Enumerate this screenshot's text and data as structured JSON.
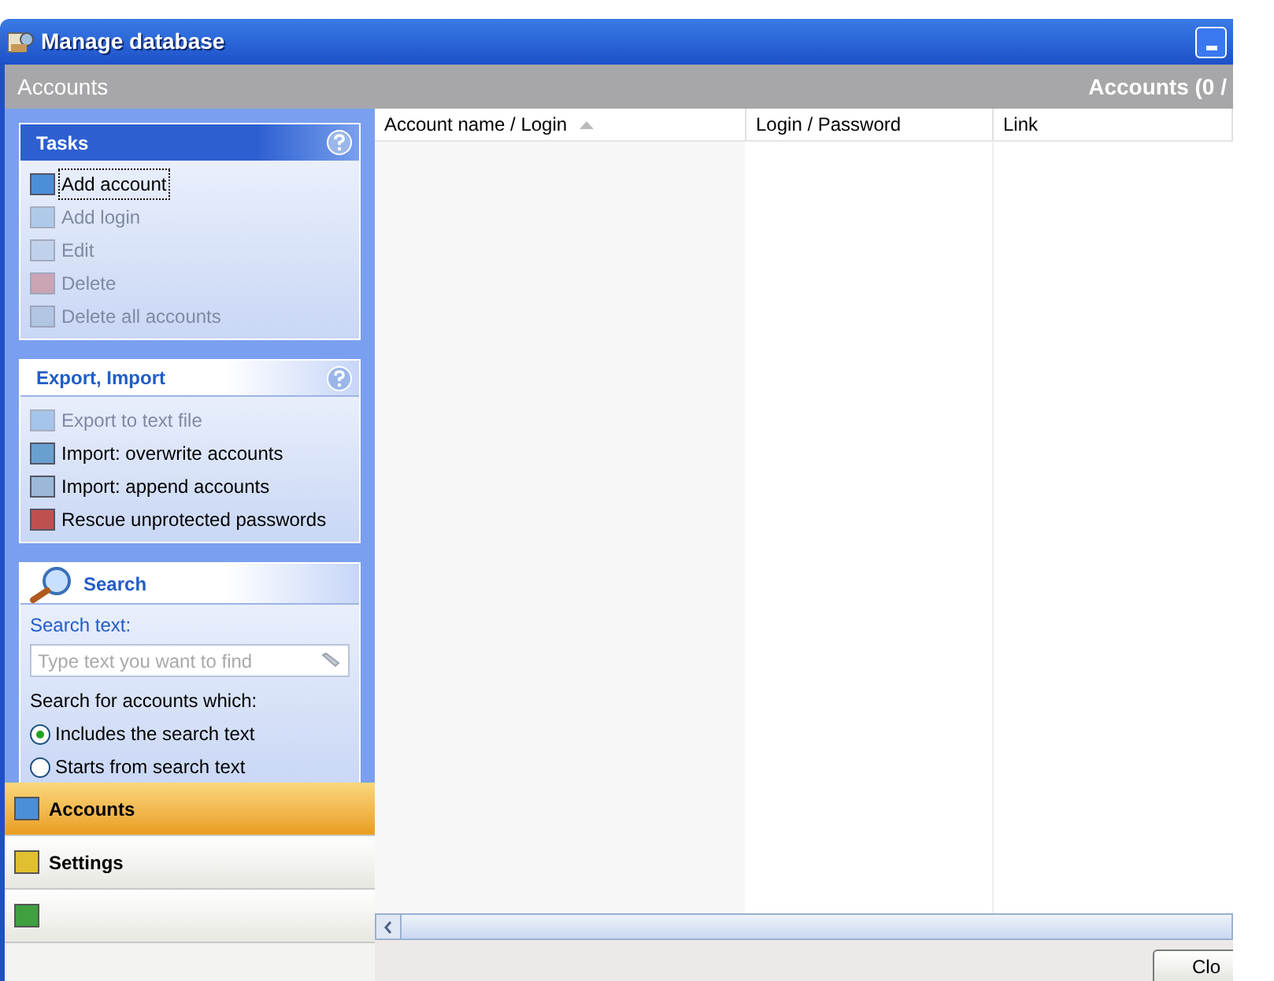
{
  "window": {
    "title": "Manage database"
  },
  "header": {
    "left": "Accounts",
    "right": "Accounts (0 /"
  },
  "panels": [
    {
      "kind": "tasks",
      "title": "Tasks",
      "help": true,
      "items": [
        {
          "label": "Add account",
          "disabled": false,
          "focused": true
        },
        {
          "label": "Add login",
          "disabled": true,
          "focused": false
        },
        {
          "label": "Edit",
          "disabled": true,
          "focused": false
        },
        {
          "label": "Delete",
          "disabled": true,
          "focused": false
        },
        {
          "label": "Delete all accounts",
          "disabled": true,
          "focused": false
        }
      ]
    },
    {
      "kind": "tasks",
      "title": "Export, Import",
      "help": true,
      "items": [
        {
          "label": "Export to text file",
          "disabled": true,
          "focused": false
        },
        {
          "label": "Import: overwrite accounts",
          "disabled": false,
          "focused": false
        },
        {
          "label": "Import: append accounts",
          "disabled": false,
          "focused": false
        },
        {
          "label": "Rescue unprotected passwords",
          "disabled": false,
          "focused": false
        }
      ]
    },
    {
      "kind": "search",
      "title": "Search",
      "help": false,
      "label": "Search text:",
      "placeholder": "Type text you want to find",
      "question": "Search for accounts which:",
      "options": [
        {
          "label": "Includes the search text",
          "selected": true
        },
        {
          "label": "Starts from search text",
          "selected": false
        }
      ]
    }
  ],
  "nav": [
    {
      "label": "Accounts",
      "selected": true
    },
    {
      "label": "Settings",
      "selected": false
    },
    {
      "selected": false
    }
  ],
  "table": {
    "columns": [
      "Account name / Login",
      "Login / Password",
      "Link"
    ]
  },
  "buttons": [
    "Clo"
  ]
}
